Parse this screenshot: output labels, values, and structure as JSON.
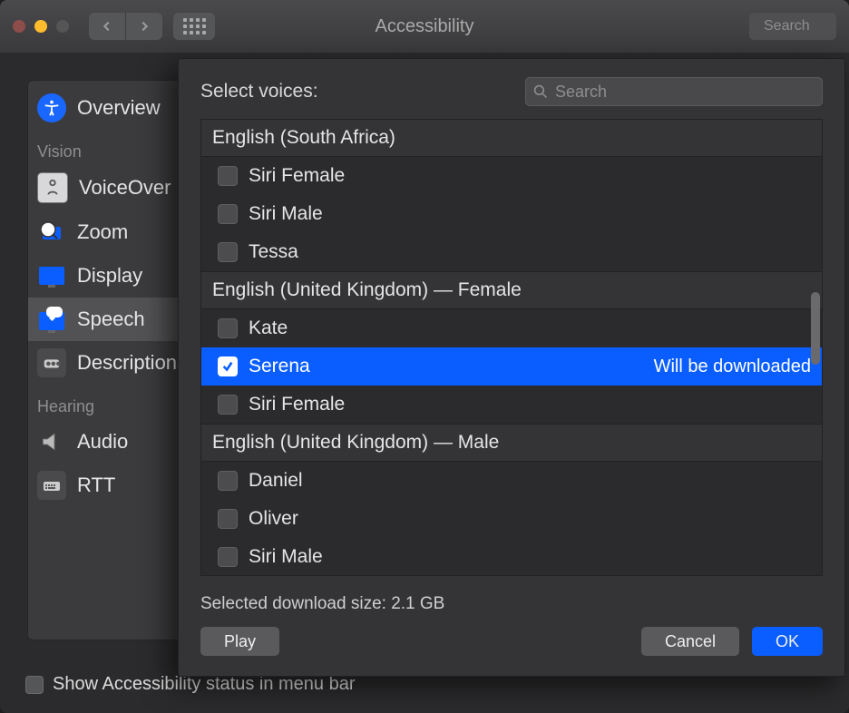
{
  "window": {
    "title": "Accessibility"
  },
  "toolbar": {
    "search_placeholder": "Search"
  },
  "sidebar": {
    "items": [
      {
        "label": "Overview"
      },
      {
        "group": "Vision"
      },
      {
        "label": "VoiceOver"
      },
      {
        "label": "Zoom"
      },
      {
        "label": "Display"
      },
      {
        "label": "Speech",
        "selected": true
      },
      {
        "label": "Descriptions"
      },
      {
        "group": "Hearing"
      },
      {
        "label": "Audio"
      },
      {
        "label": "RTT"
      }
    ]
  },
  "footer": {
    "checkbox_label": "Show Accessibility status in menu bar",
    "checked": false
  },
  "sheet": {
    "title": "Select voices:",
    "search_placeholder": "Search",
    "groups": [
      {
        "header": "English (South Africa)",
        "voices": [
          {
            "name": "Siri Female",
            "checked": false
          },
          {
            "name": "Siri Male",
            "checked": false
          },
          {
            "name": "Tessa",
            "checked": false
          }
        ]
      },
      {
        "header": "English (United Kingdom) — Female",
        "voices": [
          {
            "name": "Kate",
            "checked": false
          },
          {
            "name": "Serena",
            "checked": true,
            "selected": true,
            "status": "Will be downloaded"
          },
          {
            "name": "Siri Female",
            "checked": false
          }
        ]
      },
      {
        "header": "English (United Kingdom) — Male",
        "voices": [
          {
            "name": "Daniel",
            "checked": false
          },
          {
            "name": "Oliver",
            "checked": false
          },
          {
            "name": "Siri Male",
            "checked": false
          }
        ]
      }
    ],
    "download_size_label": "Selected download size: 2.1 GB",
    "buttons": {
      "play": "Play",
      "cancel": "Cancel",
      "ok": "OK"
    }
  }
}
